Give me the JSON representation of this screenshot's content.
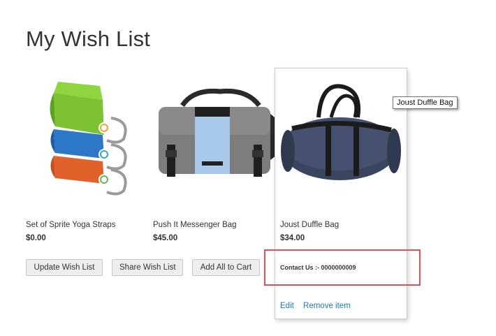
{
  "page": {
    "title": "My Wish List"
  },
  "items": [
    {
      "name": "Set of Sprite Yoga Straps",
      "price": "$0.00",
      "image": "yoga-straps"
    },
    {
      "name": "Push It Messenger Bag",
      "price": "$45.00",
      "image": "messenger-bag"
    },
    {
      "name": "Joust Duffle Bag",
      "price": "$34.00",
      "image": "duffle-bag",
      "contact": "Contact Us :- 0000000009",
      "edit_label": "Edit",
      "remove_label": "Remove item"
    }
  ],
  "tooltip": "Joust Duffle Bag",
  "actions": {
    "update_label": "Update Wish List",
    "share_label": "Share Wish List",
    "add_all_label": "Add All to Cart"
  },
  "colors": {
    "link": "#1979c3",
    "highlight": "#e0505a",
    "button_bg": "#eeeeee"
  }
}
